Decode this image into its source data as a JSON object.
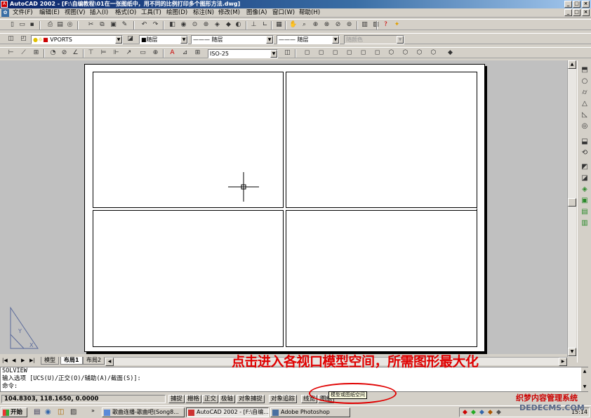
{
  "window": {
    "title": "AutoCAD 2002 - [F:\\自编教程\\01在一张图纸中，用不同的比例打印多个图形方法.dwg]"
  },
  "menubar": {
    "items": [
      "文件(F)",
      "编辑(E)",
      "视图(V)",
      "插入(I)",
      "格式(O)",
      "工具(T)",
      "绘图(D)",
      "标注(N)",
      "修改(M)",
      "图像(A)",
      "窗口(W)",
      "帮助(H)"
    ]
  },
  "toolbar2": {
    "layer_value": "VPORTS",
    "color_value": "■随层",
    "linetype_value": "——— 随层",
    "lineweight_value": "——— 随层",
    "plotstyle_value": "随颜色"
  },
  "toolbar3": {
    "dimstyle_value": "ISO-25"
  },
  "layout_tabs": [
    "模型",
    "布局1",
    "布局2"
  ],
  "active_tab": "布局1",
  "command": {
    "line1": "SOLVIEW",
    "line2": "输入选项 [UCS(U)/正交(O)/辅助(A)/截面(S)]:",
    "line3": "命令:"
  },
  "status": {
    "coords": "104.8303, 118.1650, 0.0000",
    "buttons": [
      "捕捉",
      "栅格",
      "正交",
      "极轴",
      "对象捕捉",
      "对象追踪",
      "线宽",
      "图纸"
    ],
    "tooltip": "模型或图纸空间"
  },
  "annotation": "点击进入各视口模型空间，所需图形最大化",
  "taskbar": {
    "start_label": "开始",
    "tasks": [
      {
        "label": "歌曲连播-歌曲吧(Song8..."
      },
      {
        "label": "AutoCAD 2002 - [F:\\自编..."
      },
      {
        "label": "Adobe Photoshop"
      }
    ],
    "clock": "15:14"
  },
  "watermark": {
    "line1": "织梦内容管理系统",
    "line2": "DEDECMS.COM"
  },
  "colors": {
    "annotation_red": "#e00000",
    "titlebar_blue": "#0a246a"
  }
}
